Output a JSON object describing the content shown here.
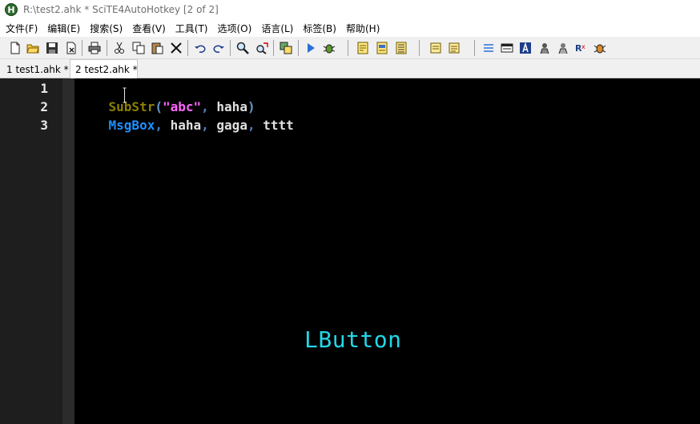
{
  "window": {
    "title": "R:\\test2.ahk * SciTE4AutoHotkey [2 of 2]",
    "app_icon_letter": "H"
  },
  "menu": {
    "items": [
      "文件(F)",
      "编辑(E)",
      "搜索(S)",
      "查看(V)",
      "工具(T)",
      "选项(O)",
      "语言(L)",
      "标签(B)",
      "帮助(H)"
    ]
  },
  "toolbar": {
    "buttons": [
      "new-file",
      "open-folder",
      "save",
      "close-file",
      "print",
      "cut",
      "copy",
      "paste",
      "delete",
      "undo",
      "redo",
      "find",
      "replace",
      "compile",
      "run",
      "debug",
      "window-spy",
      "script-info",
      "param-info",
      "doc-1",
      "doc-2",
      "list",
      "window",
      "text-a",
      "macro-1",
      "macro-2",
      "rx",
      "bug"
    ]
  },
  "tabs": [
    {
      "label": "1 test1.ahk *",
      "active": false
    },
    {
      "label": "2 test2.ahk *",
      "active": true
    }
  ],
  "editor": {
    "line_numbers": [
      "1",
      "2",
      "3"
    ],
    "lines": [
      [
        {
          "text": "SubStr",
          "kind": "func"
        },
        {
          "text": "(",
          "kind": "paren"
        },
        {
          "text": "\"abc\"",
          "kind": "str"
        },
        {
          "text": ",",
          "kind": "comma"
        },
        {
          "text": " haha",
          "kind": "ident"
        },
        {
          "text": ")",
          "kind": "paren"
        }
      ],
      [
        {
          "text": "MsgBox",
          "kind": "cmd"
        },
        {
          "text": ",",
          "kind": "comma"
        },
        {
          "text": " haha",
          "kind": "ident"
        },
        {
          "text": ",",
          "kind": "comma"
        },
        {
          "text": " gaga",
          "kind": "ident"
        },
        {
          "text": ",",
          "kind": "comma"
        },
        {
          "text": " tttt",
          "kind": "ident"
        }
      ],
      []
    ],
    "key_overlay": "LButton"
  },
  "colors": {
    "editor_bg": "#000000",
    "function": "#8b8000",
    "command": "#1e90ff",
    "string": "#ff66ff",
    "overlay": "#22d8e8"
  }
}
